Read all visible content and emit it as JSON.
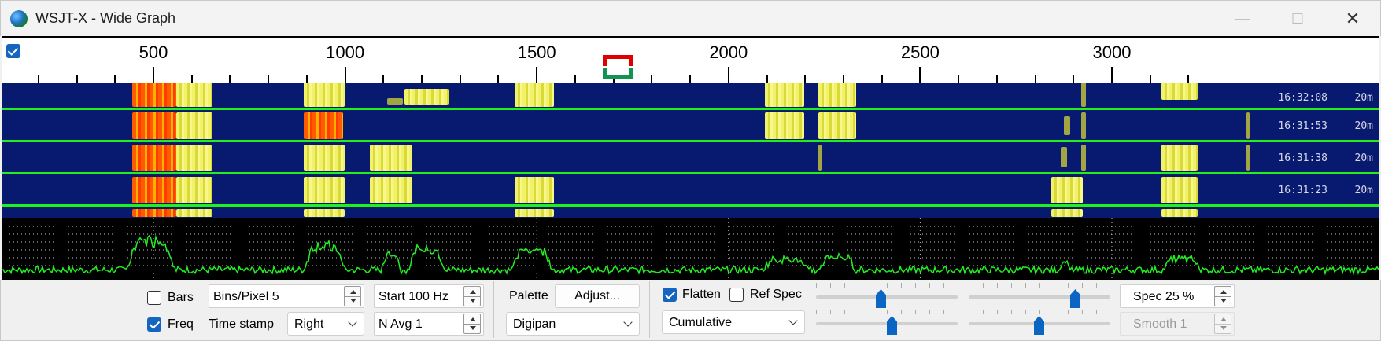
{
  "window": {
    "title": "WSJT-X - Wide Graph",
    "minimize_glyph": "—",
    "maximize_glyph": "☐",
    "close_glyph": "✕"
  },
  "ruler": {
    "labels": [
      "500",
      "1000",
      "1500",
      "2000",
      "2500",
      "3000"
    ]
  },
  "waterfall": {
    "rows": [
      {
        "time": "16:32:08",
        "band": "20m"
      },
      {
        "time": "16:31:53",
        "band": "20m"
      },
      {
        "time": "16:31:38",
        "band": "20m"
      },
      {
        "time": "16:31:23",
        "band": "20m"
      }
    ]
  },
  "controls": {
    "bars_label": "Bars",
    "bars_checked": false,
    "freq_label": "Freq",
    "freq_checked": true,
    "bins_per_pixel": "Bins/Pixel  5",
    "time_stamp_label": "Time stamp",
    "time_stamp_value": "Right",
    "start": "Start 100 Hz",
    "n_avg": "N Avg 1",
    "palette_label": "Palette",
    "adjust_button": "Adjust...",
    "palette_value": "Digipan",
    "flatten_label": "Flatten",
    "flatten_checked": true,
    "ref_spec_label": "Ref Spec",
    "ref_spec_checked": false,
    "spectrum_mode": "Cumulative",
    "spec_percent": "Spec 25 %",
    "smooth": "Smooth  1"
  },
  "colors": {
    "waterfall_bg": "#081a70",
    "separator": "#1ff01f",
    "spectrum_line": "#22ee22",
    "accent": "#1565c0"
  }
}
